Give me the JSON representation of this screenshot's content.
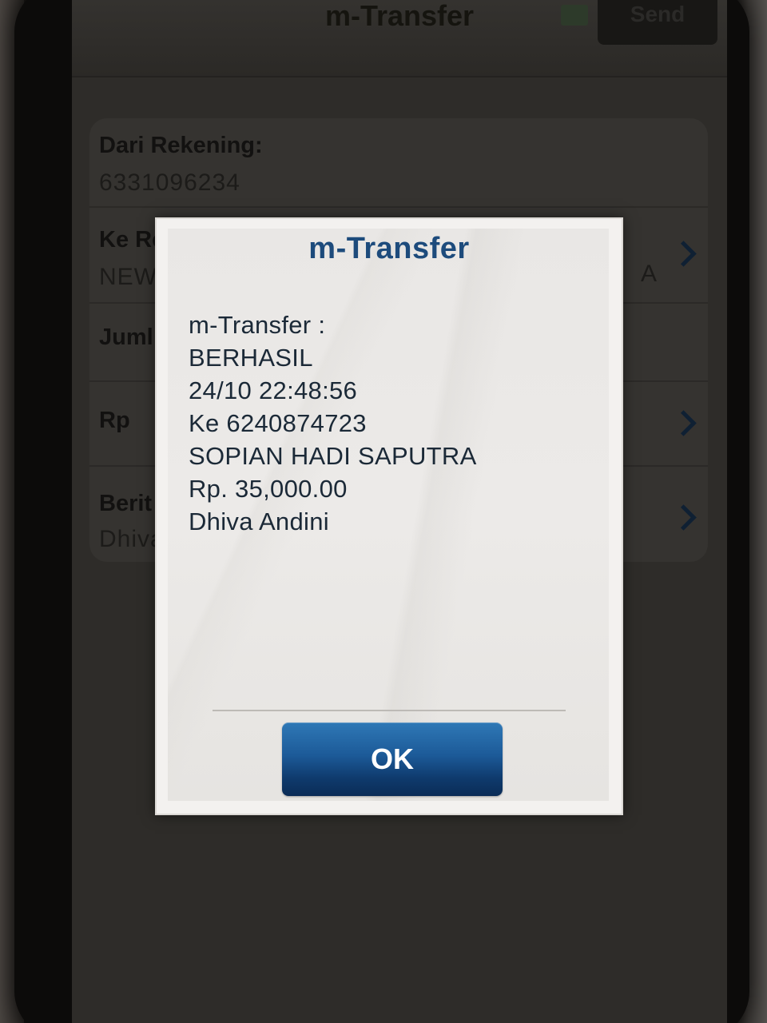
{
  "app_bar": {
    "title": "m-Transfer",
    "send_label": "Send"
  },
  "form": {
    "from_account": {
      "label": "Dari Rekening:",
      "value": "6331096234"
    },
    "to_account": {
      "label": "Ke Re",
      "value": "NEW",
      "value_right": "A"
    },
    "amount_label": {
      "label": "Juml"
    },
    "currency": {
      "label": "Rp"
    },
    "message": {
      "label": "Berit",
      "value": "Dhiva"
    }
  },
  "dialog": {
    "title": "m-Transfer",
    "lines": [
      "m-Transfer :",
      "BERHASIL",
      "24/10 22:48:56",
      "Ke 6240874723",
      "SOPIAN HADI SAPUTRA",
      "Rp. 35,000.00",
      "Dhiva Andini"
    ],
    "ok_label": "OK"
  }
}
